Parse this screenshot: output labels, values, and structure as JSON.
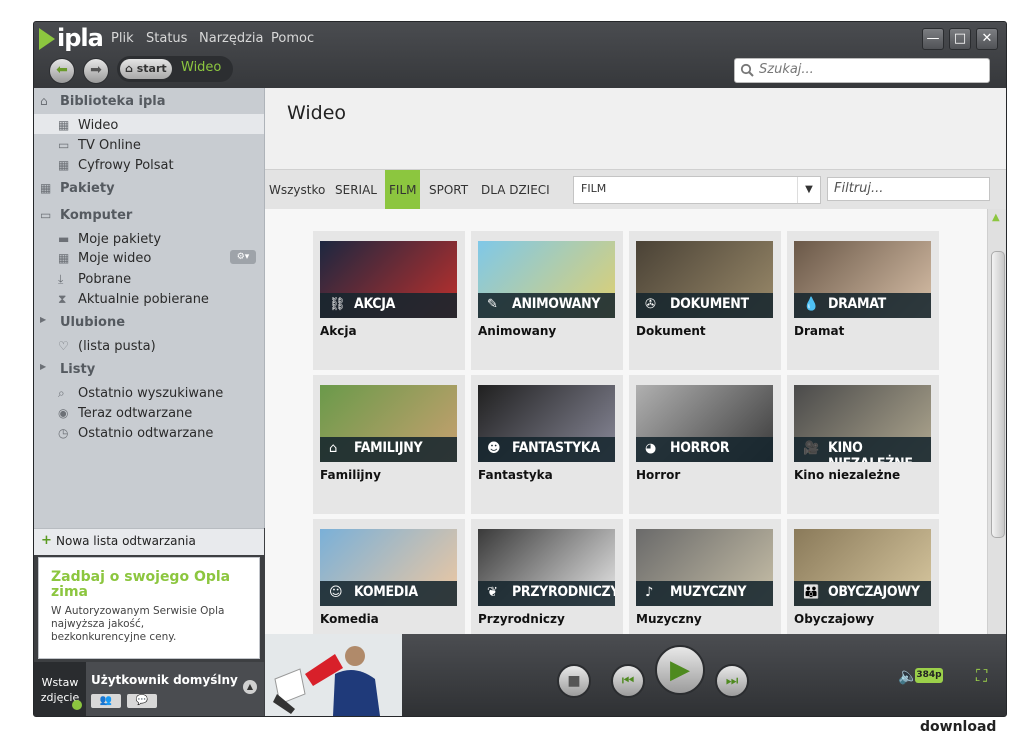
{
  "app": {
    "logo": "ipla"
  },
  "menu": [
    "Plik",
    "Status",
    "Narzędzia",
    "Pomoc"
  ],
  "window_buttons": {
    "minimize": "—",
    "maximize": "□",
    "close": "✕"
  },
  "nav": {
    "breadcrumb_start": "start",
    "breadcrumb_current": "Wideo"
  },
  "search": {
    "placeholder": "Szukaj..."
  },
  "sidebar": {
    "sections": [
      {
        "label": "Biblioteka ipla",
        "items": [
          "Wideo",
          "TV Online",
          "Cyfrowy Polsat"
        ]
      },
      {
        "label": "Pakiety",
        "items": []
      },
      {
        "label": "Komputer",
        "items": [
          "Moje pakiety",
          "Moje wideo",
          "Pobrane",
          "Aktualnie pobierane"
        ]
      },
      {
        "label": "Ulubione",
        "items": [
          "(lista pusta)"
        ]
      },
      {
        "label": "Listy",
        "items": [
          "Ostatnio wyszukiwane",
          "Teraz odtwarzane",
          "Ostatnio odtwarzane"
        ]
      }
    ],
    "selected": "Wideo",
    "new_playlist": "Nowa lista odtwarzania",
    "promo": {
      "title": "Zadbaj o swojego Opla zima",
      "body": "W Autoryzowanym Serwisie Opla najwyższa jakość, bezkonkurencyjne ceny."
    },
    "user": {
      "avatar_text": "Wstaw zdjęcie",
      "name": "Użytkownik domyślny"
    }
  },
  "main": {
    "title": "Wideo",
    "filter_tabs": [
      "Wszystko",
      "SERIAL",
      "FILM",
      "SPORT",
      "DLA DZIECI"
    ],
    "active_tab": "FILM",
    "dropdown_value": "FILM",
    "filter_placeholder": "Filtruj...",
    "genres": [
      {
        "band": "AKCJA",
        "label": "Akcja",
        "icon": "handcuffs-icon"
      },
      {
        "band": "ANIMOWANY",
        "label": "Animowany",
        "icon": "pencil-icon"
      },
      {
        "band": "DOKUMENT",
        "label": "Dokument",
        "icon": "film-reel-icon"
      },
      {
        "band": "DRAMAT",
        "label": "Dramat",
        "icon": "teardrop-icon"
      },
      {
        "band": "FAMILIJNY",
        "label": "Familijny",
        "icon": "house-icon"
      },
      {
        "band": "FANTASTYKA",
        "label": "Fantastyka",
        "icon": "alien-icon"
      },
      {
        "band": "HORROR",
        "label": "Horror",
        "icon": "pumpkin-icon"
      },
      {
        "band": "KINO NIEZALEŻNE",
        "label": "Kino niezależne",
        "icon": "camera-icon"
      },
      {
        "band": "KOMEDIA",
        "label": "Komedia",
        "icon": "comedy-icon"
      },
      {
        "band": "PRZYRODNICZY",
        "label": "Przyrodniczy",
        "icon": "leaf-icon"
      },
      {
        "band": "MUZYCZNY",
        "label": "Muzyczny",
        "icon": "guitar-icon"
      },
      {
        "band": "OBYCZAJOWY",
        "label": "Obyczajowy",
        "icon": "people-icon"
      }
    ]
  },
  "player": {
    "quality": "384p"
  },
  "watermark": "download"
}
